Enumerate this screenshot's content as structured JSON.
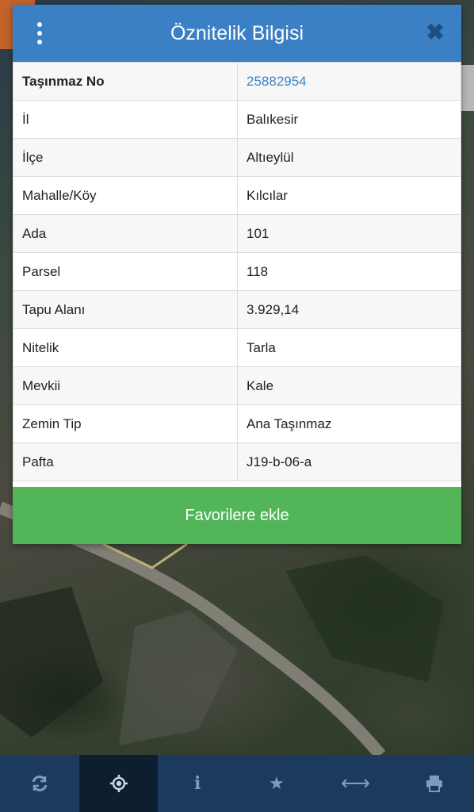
{
  "dialog": {
    "title": "Öznitelik Bilgisi",
    "close_glyph": "✖",
    "rows": [
      {
        "key": "Taşınmaz No",
        "value": "25882954"
      },
      {
        "key": "İl",
        "value": "Balıkesir"
      },
      {
        "key": "İlçe",
        "value": "Altıeylül"
      },
      {
        "key": "Mahalle/Köy",
        "value": "Kılcılar"
      },
      {
        "key": "Ada",
        "value": "101"
      },
      {
        "key": "Parsel",
        "value": "118"
      },
      {
        "key": "Tapu Alanı",
        "value": "3.929,14"
      },
      {
        "key": "Nitelik",
        "value": "Tarla"
      },
      {
        "key": "Mevkii",
        "value": "Kale"
      },
      {
        "key": "Zemin Tip",
        "value": "Ana Taşınmaz"
      },
      {
        "key": "Pafta",
        "value": "J19-b-06-a"
      }
    ],
    "favorite_label": "Favorilere ekle"
  },
  "toolbar": {
    "items": [
      {
        "icon": "refresh-icon",
        "active": false
      },
      {
        "icon": "crosshair-icon",
        "active": true
      },
      {
        "icon": "info-icon",
        "active": false,
        "glyph": "i"
      },
      {
        "icon": "star-icon",
        "active": false,
        "glyph": "★"
      },
      {
        "icon": "measure-arrows-icon",
        "active": false,
        "glyph": "⟷"
      },
      {
        "icon": "print-icon",
        "active": false
      }
    ]
  },
  "colors": {
    "header": "#3b7fc4",
    "favorite_button": "#52b55a",
    "toolbar": "#1c3a5c",
    "toolbar_active": "#0d1e31",
    "link_value": "#3a86c8"
  }
}
